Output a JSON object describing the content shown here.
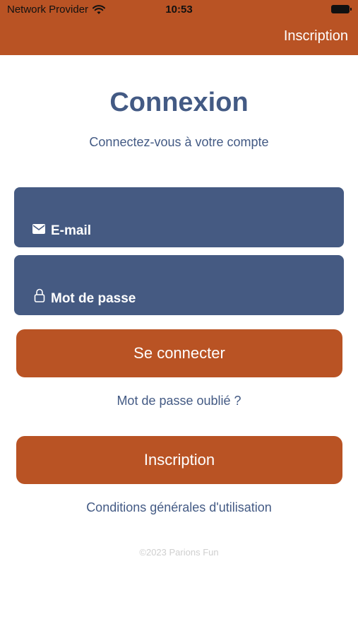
{
  "status_bar": {
    "carrier": "Network Provider",
    "time": "10:53",
    "icons": [
      "wifi-icon",
      "battery-icon"
    ]
  },
  "nav": {
    "signup_link": "Inscription"
  },
  "colors": {
    "brand_orange": "#b95324",
    "brand_blue": "#455a82",
    "text_blue": "#435a84"
  },
  "login": {
    "title": "Connexion",
    "subtitle": "Connectez-vous à votre compte",
    "email_placeholder": "E-mail",
    "email_icon": "envelope-icon",
    "password_placeholder": "Mot de passe",
    "password_icon": "lock-icon",
    "submit_label": "Se connecter",
    "forgot_password": "Mot de passe oublié ?",
    "signup_button": "Inscription",
    "terms_link": "Conditions générales d'utilisation",
    "copyright": "©2023 Parions Fun"
  }
}
